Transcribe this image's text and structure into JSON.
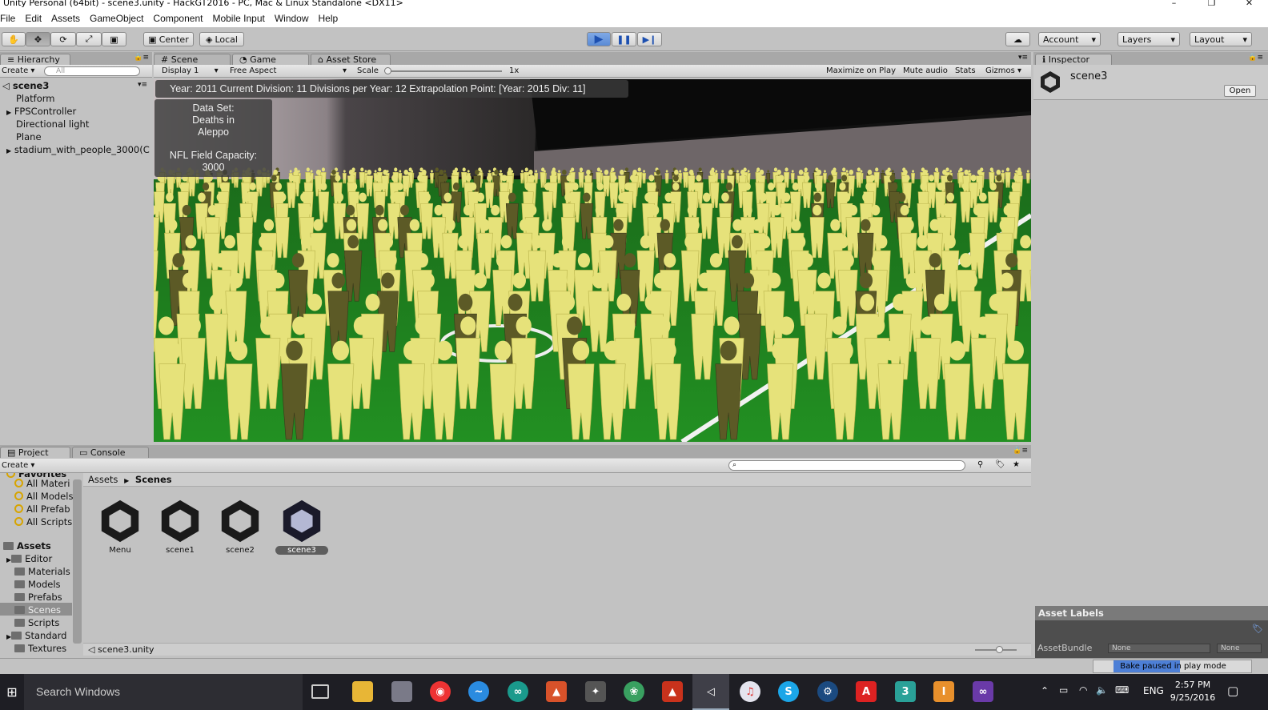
{
  "window": {
    "title": "Unity Personal (64bit) - scene3.unity - HackGT2016 - PC, Mac & Linux Standalone <DX11>",
    "controls": [
      "–",
      "❐",
      "✕"
    ]
  },
  "menu": [
    "File",
    "Edit",
    "Assets",
    "GameObject",
    "Component",
    "Mobile Input",
    "Window",
    "Help"
  ],
  "toolbar": {
    "pivot": "Center",
    "space": "Local",
    "account": "Account",
    "layers": "Layers",
    "layout": "Layout",
    "play_state": "playing"
  },
  "hierarchy": {
    "tab": "Hierarchy",
    "create": "Create",
    "search_placeholder": "All",
    "scene": "scene3",
    "items": [
      "Platform",
      "FPSController",
      "Directional light",
      "Plane",
      "stadium_with_people_3000(C"
    ]
  },
  "center_tabs": [
    "Scene",
    "Game",
    "Asset Store"
  ],
  "game_bar": {
    "display": "Display 1",
    "aspect": "Free Aspect",
    "scale_label": "Scale",
    "scale_value": "1x",
    "maximize": "Maximize on Play",
    "mute": "Mute audio",
    "stats": "Stats",
    "gizmos": "Gizmos"
  },
  "game_view": {
    "status": "Year: 2011  Current Division: 11  Divisions per Year: 12 Extrapolation Point: [Year: 2015  Div: 11]",
    "dataset_label": "Data Set:",
    "dataset_value_1": "Deaths in",
    "dataset_value_2": "Aleppo",
    "capacity_label": "NFL Field Capacity:",
    "capacity_value": "3000"
  },
  "inspector": {
    "tab": "Inspector",
    "object": "scene3",
    "open": "Open",
    "asset_labels": "Asset Labels",
    "assetbundle": "AssetBundle",
    "none1": "None",
    "none2": "None"
  },
  "bottom_tabs": [
    "Project",
    "Console"
  ],
  "project": {
    "create": "Create",
    "favorites": "Favorites",
    "fav_items": [
      "All Materi",
      "All Models",
      "All Prefab",
      "All Scripts"
    ],
    "assets_root": "Assets",
    "folders": [
      "Editor",
      "Materials",
      "Models",
      "Prefabs",
      "Scenes",
      "Scripts",
      "Standard",
      "Textures"
    ],
    "breadcrumb_root": "Assets",
    "breadcrumb_leaf": "Scenes",
    "scenes": [
      "Menu",
      "scene1",
      "scene2",
      "scene3"
    ],
    "selected_file": "scene3.unity"
  },
  "statusbar": {
    "bake": "Bake paused in play mode"
  },
  "taskbar": {
    "search": "Search Windows",
    "lang": "ENG",
    "time": "2:57 PM",
    "date": "9/25/2016"
  },
  "colors": {
    "field": "#1f8a1f",
    "people": "#e6e27a",
    "people_dark": "#5c5a26",
    "play_blue": "#5b8bd6",
    "taskbar": "#1e1e24"
  }
}
